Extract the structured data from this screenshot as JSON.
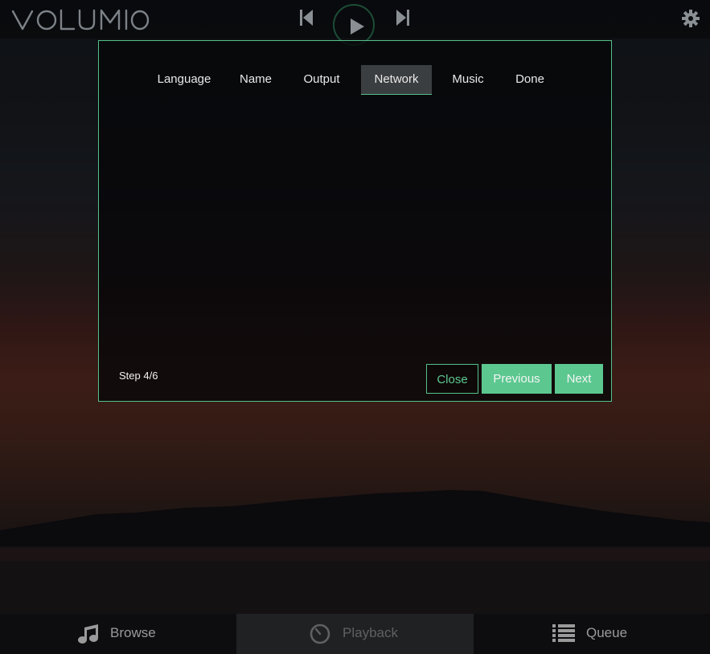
{
  "app": {
    "logo_text": "VOLUMIO"
  },
  "topbar": {
    "previous_icon": "skip-previous-icon",
    "play_icon": "play-icon",
    "next_icon": "skip-next-icon",
    "settings_icon": "gear-icon"
  },
  "wizard": {
    "steps": [
      {
        "label": "Language"
      },
      {
        "label": "Name"
      },
      {
        "label": "Output"
      },
      {
        "label": "Network"
      },
      {
        "label": "Music"
      },
      {
        "label": "Done"
      }
    ],
    "active_step": "Network",
    "step_counter": "Step 4/6",
    "buttons": {
      "close": "Close",
      "previous": "Previous",
      "next": "Next"
    }
  },
  "bottom_nav": {
    "items": [
      {
        "label": "Browse",
        "icon": "music-note-icon"
      },
      {
        "label": "Playback",
        "icon": "clock-icon",
        "active": true
      },
      {
        "label": "Queue",
        "icon": "list-icon"
      }
    ]
  },
  "colors": {
    "accent": "#5cc890",
    "accent_border": "#54c08a",
    "active_tab_bg": "#3b3e40"
  }
}
